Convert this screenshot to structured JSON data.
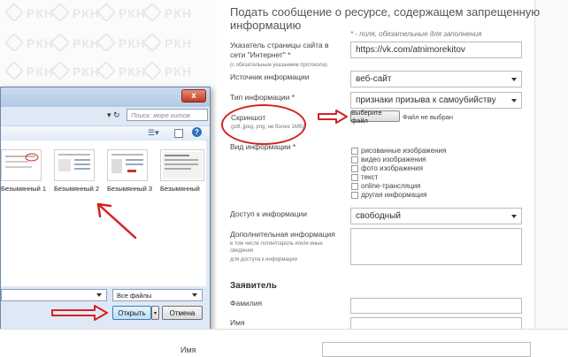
{
  "watermark": {
    "text": "РКН"
  },
  "form": {
    "title": "Подать сообщение о ресурсе, содержащем запрещенную информацию",
    "required_note": "* - поля, обязательные для заполнения",
    "url": {
      "label": "Указатель страницы сайта в сети \"Интернет\" *",
      "sublabel": "(с обязательным указанием протокола)",
      "value": "https://vk.com/atnimorekitov"
    },
    "source": {
      "label": "Источник информации",
      "value": "веб-сайт"
    },
    "type": {
      "label": "Тип информации *",
      "value": "признаки призыва к самоубийству"
    },
    "screenshot": {
      "label": "Скриншот",
      "sublabel": "(pdf, jpeg, png; не более 1Мб)",
      "button": "Выберите файл",
      "status": "Файл не выбран"
    },
    "kind": {
      "label": "Вид информации *",
      "options": [
        "рисованные изображения",
        "видео изображения",
        "фото изображения",
        "текст",
        "online-трансляция",
        "другая информация"
      ]
    },
    "access": {
      "label": "Доступ к информации",
      "value": "свободный"
    },
    "extra": {
      "label": "Дополнительная информация",
      "sublabel1": "в том числе логин/пароль и/или иные сведения",
      "sublabel2": "для доступа к информации"
    },
    "applicant": {
      "section": "Заявитель",
      "surname": "Фамилия",
      "name": "Имя"
    }
  },
  "dialog": {
    "search_placeholder": "Поиск: море китов",
    "close": "x",
    "files": [
      "Безымянный 1",
      "Безымянный 2",
      "Безымянный 3",
      "Безымянный"
    ],
    "filter": "Все файлы",
    "open": "Открыть",
    "cancel": "Отмена"
  },
  "bottom": {
    "name_label": "Имя"
  },
  "colors": {
    "annotation": "#d42222",
    "dialog_bg": "#dfe9f5"
  }
}
